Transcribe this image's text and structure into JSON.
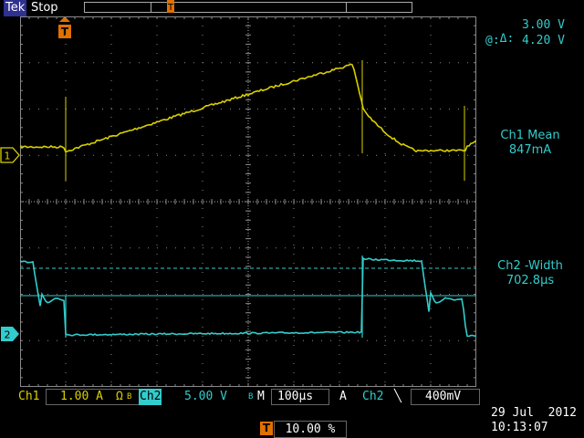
{
  "header": {
    "brand": "Tek",
    "run_state": "Stop"
  },
  "cursor_readout": {
    "delta_label": "Δ:",
    "delta_value": "3.00 V",
    "at_label": "@:",
    "at_value": "4.20 V"
  },
  "measurements": [
    {
      "label": "Ch1 Mean",
      "value": "847mA"
    },
    {
      "label": "Ch2 -Width",
      "value": "702.8µs"
    }
  ],
  "channel_markers": {
    "ch1": "1",
    "ch2": "2"
  },
  "bottom_bar": {
    "ch1_label": "Ch1",
    "ch1_scale": "1.00 A",
    "ch1_coupling": "Ω",
    "bw_glyph": "B",
    "ch2_label": "Ch2",
    "ch2_scale": "5.00 V",
    "timebase_prefix": "M",
    "timebase": "100µs",
    "trigger_mode": "A",
    "trigger_source": "Ch2",
    "trigger_slope": "╲",
    "trigger_level": "400mV"
  },
  "trigger_position": {
    "icon": "T",
    "percent": "10.00 %"
  },
  "timestamp": {
    "date": "29 Jul  2012",
    "time": "10:13:07"
  },
  "colors": {
    "ch1": "#d8d000",
    "ch2": "#33cccc",
    "grid": "#8a8a8a",
    "cursor": "#33cccc",
    "trigger": "#e07000"
  },
  "icons": {
    "trigger_marker": "trigger-arrow-icon",
    "slope": "falling-edge-icon"
  }
}
